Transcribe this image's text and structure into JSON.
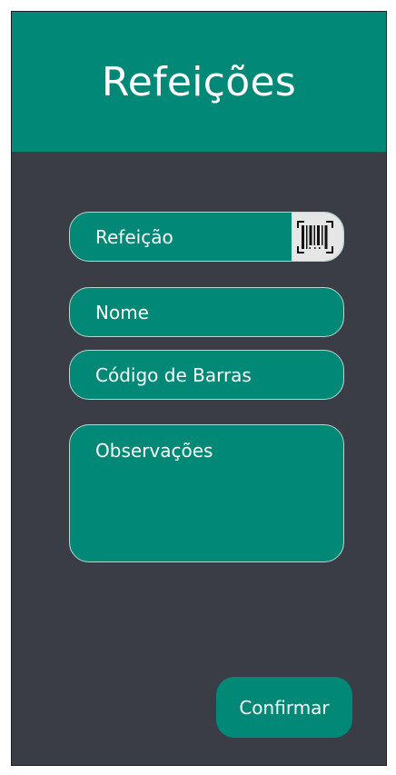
{
  "header": {
    "title": "Refeições"
  },
  "form": {
    "refeicao_placeholder": "Refeição",
    "nome_placeholder": "Nome",
    "codigo_placeholder": "Código de Barras",
    "observacoes_placeholder": "Observações",
    "barcode_icon": "barcode-scan-icon"
  },
  "actions": {
    "confirm_label": "Confirmar"
  },
  "colors": {
    "primary": "#018877",
    "background": "#3a3d45",
    "field_border": "#b9d4cf",
    "scan_button": "#e6e6e6"
  }
}
